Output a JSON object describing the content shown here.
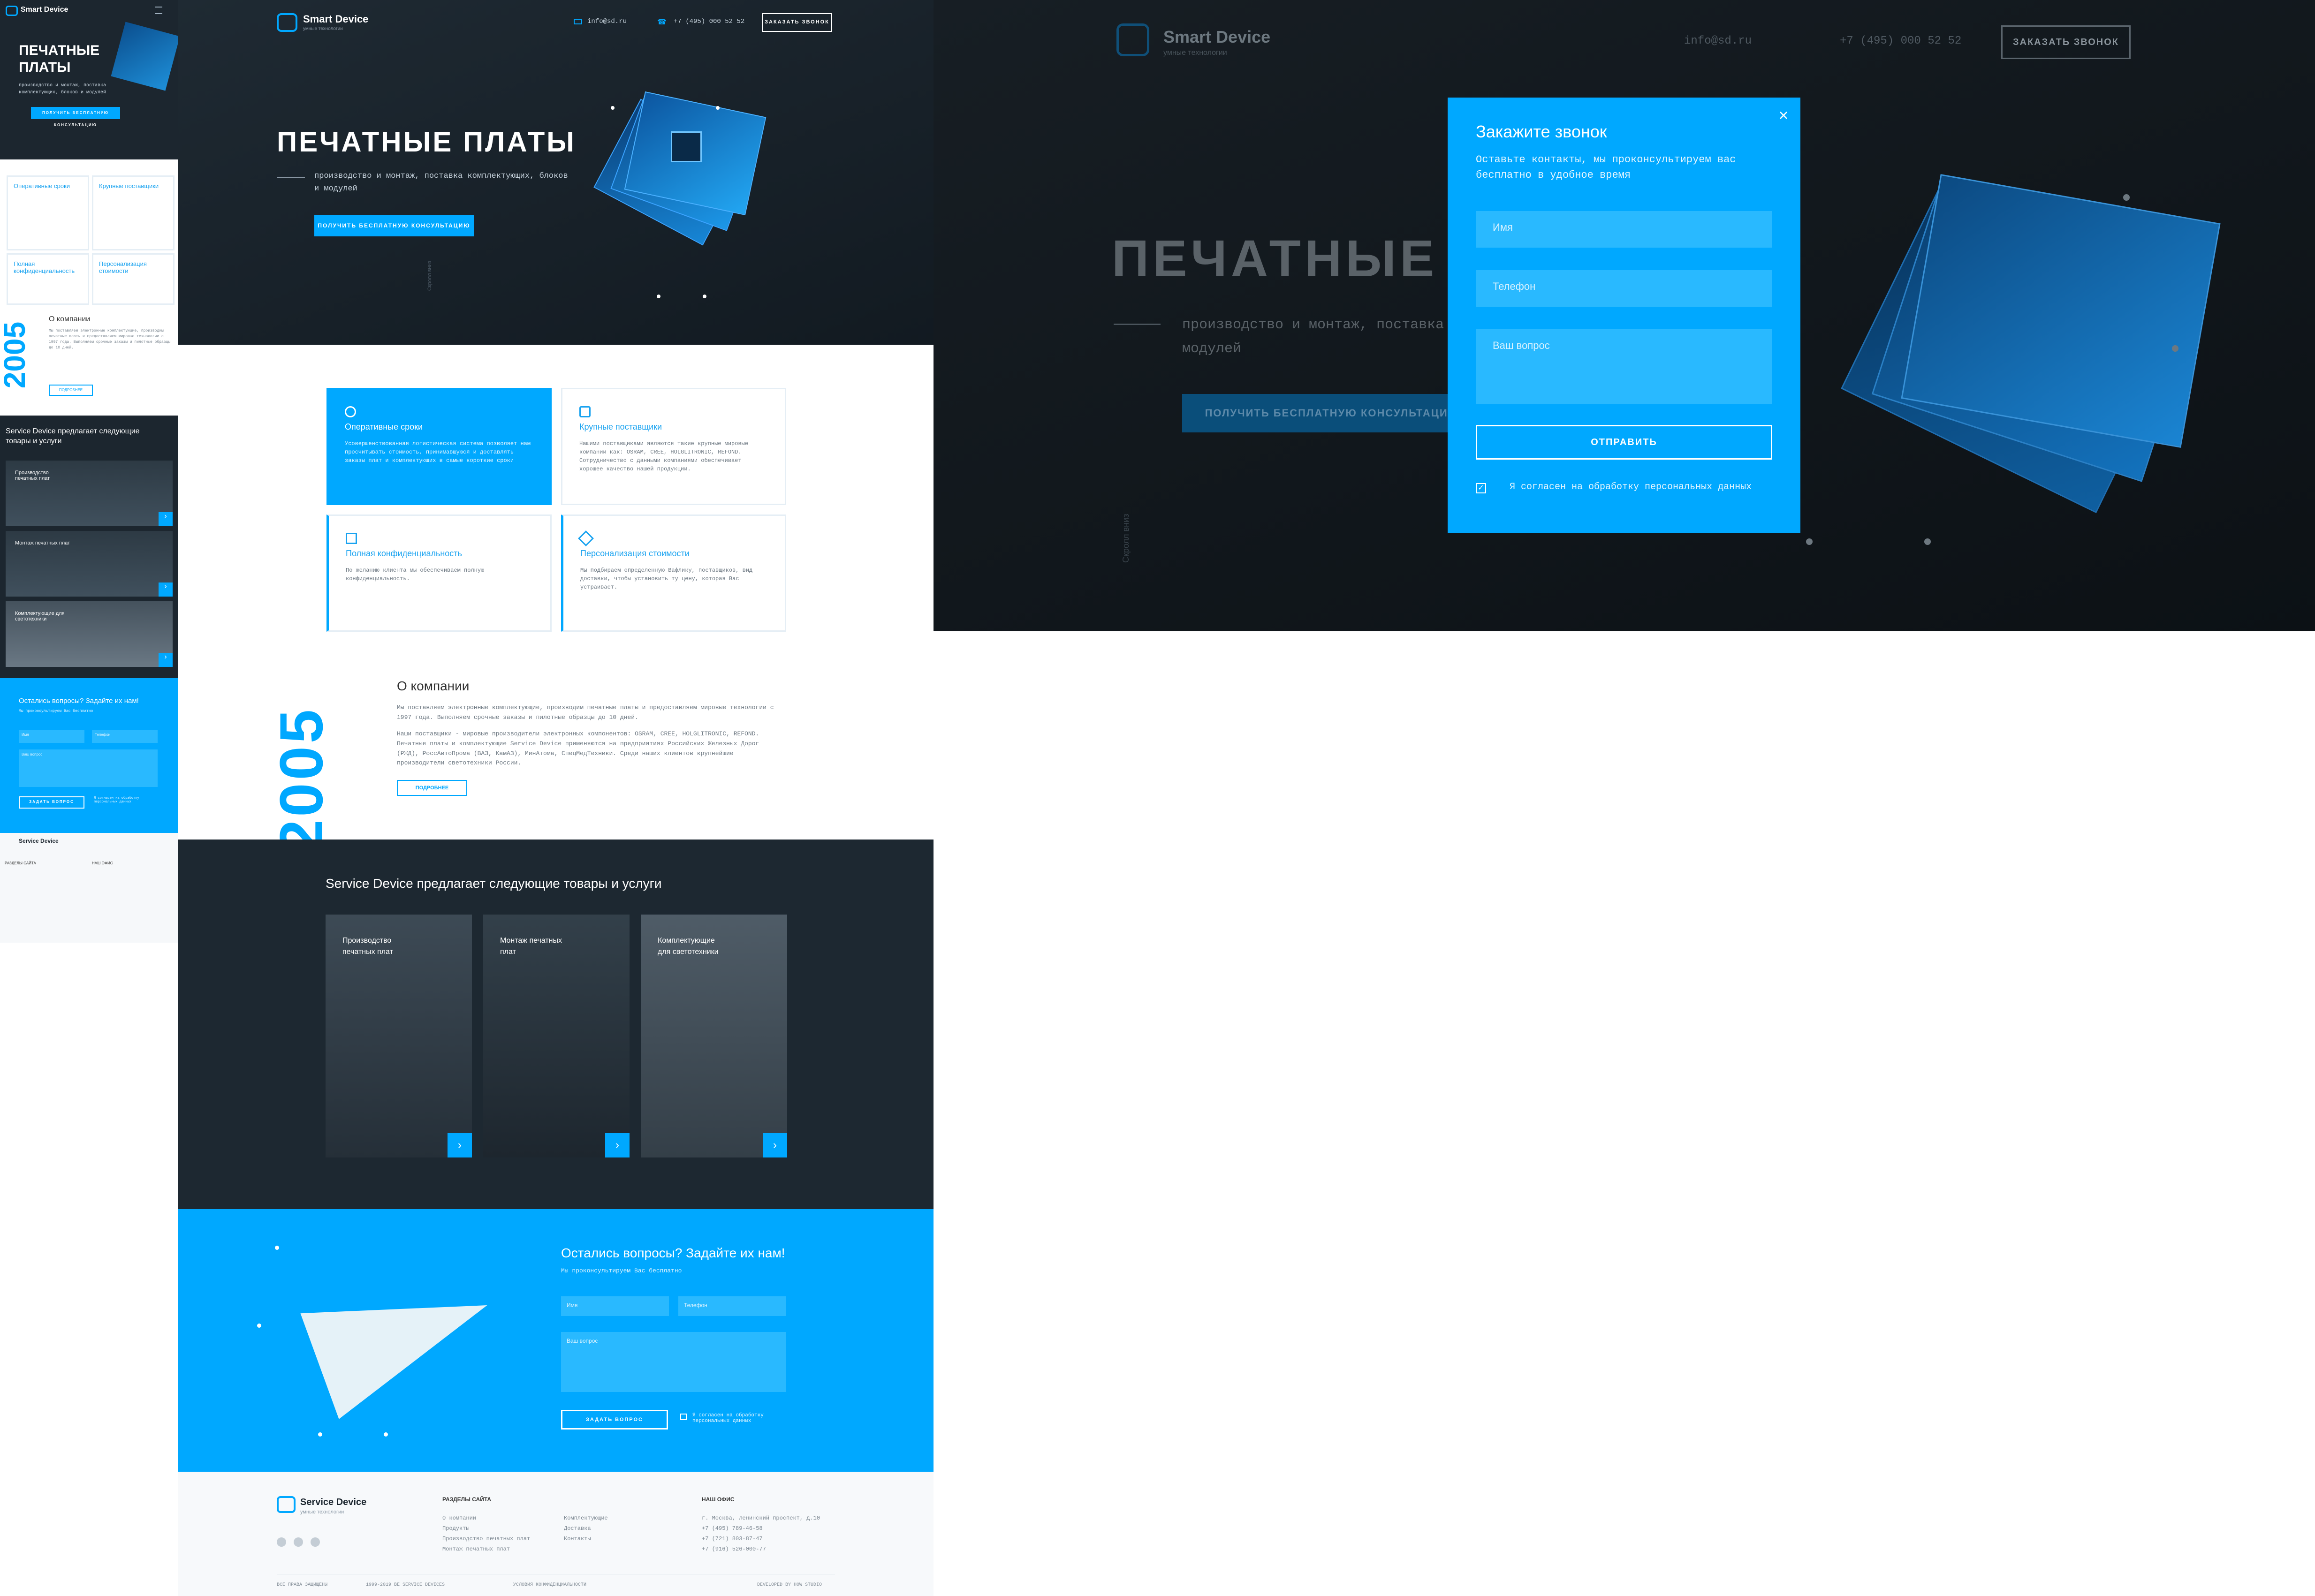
{
  "brand": {
    "name": "Smart Device",
    "tagline": "умные технологии",
    "footer_name": "Service Device",
    "footer_tagline": "умные технологии"
  },
  "header": {
    "email": "info@sd.ru",
    "phone": "+7 (495) 000 52 52",
    "call_button": "ЗАКАЗАТЬ ЗВОНОК"
  },
  "hero": {
    "title": "ПЕЧАТНЫЕ ПЛАТЫ",
    "subtitle": "производство и монтаж, поставка комплектующих, блоков и модулей",
    "cta": "ПОЛУЧИТЬ БЕСПЛАТНУЮ КОНСУЛЬТАЦИЮ",
    "scroll": "Скролл вниз"
  },
  "features": [
    {
      "title": "Оперативные сроки",
      "text": "Усовершенствованная логистическая система позволяет нам просчитывать стоимость, принимавшуюся и доставлять заказы плат и комплектующих в самые короткие сроки",
      "icon": "clock-icon"
    },
    {
      "title": "Крупные поставщики",
      "text": "Нашими поставщиками являются такие крупные мировые компании как: OSRAM, CREE, HOLGLITRONIC, REFOND. Сотрудничество с данными компаниями обеспечивает хорошее качество нашей продукции.",
      "icon": "network-icon"
    },
    {
      "title": "Полная конфиденциальность",
      "text": "По желанию клиента мы обеспечиваем полную конфиденциальность.",
      "icon": "printer-icon"
    },
    {
      "title": "Персонализация стоимости",
      "text": "Мы подбираем определенную Вафлику, поставщиков, вид доставки, чтобы установить ту цену, которая Вас устраивает.",
      "icon": "tag-icon"
    }
  ],
  "about": {
    "year": "2005",
    "title": "О компании",
    "p1": "Мы поставляем электронные комплектующие, производим печатные платы и предоставляем мировые технологии с 1997 года. Выполняем срочные заказы и пилотные образцы до 10 дней.",
    "p2": "Наши поставщики - мировые производители электронных компонентов: OSRAM, CREE, HOLGLITRONIC, REFOND. Печатные платы и комплектующие Service Device применяются на предприятиях Российских Железных Дорог (РЖД), РоссАвтоПрома (ВАЗ, КамАЗ), МинАтома, СпецМедТехники. Среди наших клиентов крупнейшие производители светотехники России.",
    "more": "ПОДРОБНЕЕ"
  },
  "products": {
    "title": "Service Device предлагает следующие товары и услуги",
    "items": [
      "Производство печатных плат",
      "Монтаж печатных плат",
      "Комплектующие для светотехники"
    ]
  },
  "contact": {
    "title": "Остались вопросы? Задайте их нам!",
    "subtitle": "Мы проконсультируем Вас бесплатно",
    "name_ph": "Имя",
    "phone_ph": "Телефон",
    "question_ph": "Ваш вопрос",
    "submit": "ЗАДАТЬ ВОПРОС",
    "consent": "Я согласен на обработку персональных данных"
  },
  "footer": {
    "sections_title": "РАЗДЕЛЫ САЙТА",
    "links_col1": [
      "О компании",
      "Продукты",
      "Производство печатных плат",
      "Монтаж печатных плат"
    ],
    "links_col2": [
      "Комплектующие",
      "Доставка",
      "Контакты"
    ],
    "office_title": "НАШ ОФИС",
    "address": "г. Москва, Ленинский проспект, д.10",
    "phones": [
      "+7 (495) 789-46-58",
      "+7 (721) 803-87-47",
      "+7 (916) 526-000-77"
    ],
    "rights": "ВСЕ ПРАВА ЗАЩИЩЕНЫ",
    "copyright": "1999-2019 BE SERVICE DEVICES",
    "policy": "УСЛОВИЯ КОНФИДЕНЦИАЛЬНОСТИ",
    "developer": "DEVELOPED BY HOW STUDIO"
  },
  "modal": {
    "title": "Закажите звонок",
    "subtitle": "Оставьте контакты, мы проконсультируем вас бесплатно в удобное время",
    "name_ph": "Имя",
    "phone_ph": "Телефон",
    "question_ph": "Ваш вопрос",
    "submit": "ОТПРАВИТЬ",
    "consent": "Я согласен на обработку персональных данных"
  },
  "mobile": {
    "title": "ПЕЧАТНЫЕ ПЛАТЫ",
    "cta": "ПОЛУЧИТЬ БЕСПЛАТНУЮ КОНСУЛЬТАЦИЮ"
  },
  "colors": {
    "accent": "#00a8ff",
    "dark": "#1c262f",
    "darker": "#151d24"
  }
}
